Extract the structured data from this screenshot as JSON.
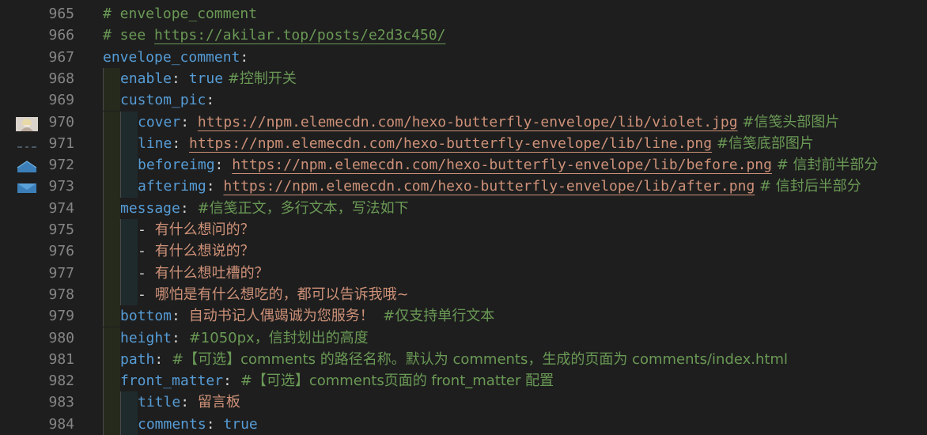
{
  "editor": {
    "lines": [
      {
        "no": "965",
        "parts": [
          {
            "t": "# envelope_comment",
            "c": "comment"
          }
        ]
      },
      {
        "no": "966",
        "parts": [
          {
            "t": "# see ",
            "c": "comment"
          },
          {
            "t": "https://akilar.top/posts/e2d3c450/",
            "c": "url-c"
          }
        ]
      },
      {
        "no": "967",
        "parts": [
          {
            "t": "envelope_comment",
            "c": "key"
          },
          {
            "t": ":",
            "c": "punct"
          }
        ]
      },
      {
        "no": "968",
        "indent": 1,
        "parts": [
          {
            "t": "enable",
            "c": "key"
          },
          {
            "t": ": ",
            "c": "punct"
          },
          {
            "t": "true",
            "c": "bool"
          },
          {
            "t": " #控制开关",
            "c": "cmt-cjk"
          }
        ]
      },
      {
        "no": "969",
        "indent": 1,
        "parts": [
          {
            "t": "custom_pic",
            "c": "key"
          },
          {
            "t": ":",
            "c": "punct"
          }
        ]
      },
      {
        "no": "970",
        "indent": 2,
        "gutter": "avatar-thumbnail",
        "parts": [
          {
            "t": "cover",
            "c": "key"
          },
          {
            "t": ": ",
            "c": "punct"
          },
          {
            "t": "https://npm.elemecdn.com/hexo-butterfly-envelope/lib/violet.jpg",
            "c": "url-s"
          },
          {
            "t": " #信笺头部图片",
            "c": "cmt-cjk"
          }
        ]
      },
      {
        "no": "971",
        "indent": 2,
        "gutter": "line-thumbnail",
        "parts": [
          {
            "t": "line",
            "c": "key"
          },
          {
            "t": ": ",
            "c": "punct"
          },
          {
            "t": "https://npm.elemecdn.com/hexo-butterfly-envelope/lib/line.png",
            "c": "url-s"
          },
          {
            "t": " #信笺底部图片",
            "c": "cmt-cjk"
          }
        ]
      },
      {
        "no": "972",
        "indent": 2,
        "gutter": "envelope-top-thumbnail",
        "parts": [
          {
            "t": "beforeimg",
            "c": "key"
          },
          {
            "t": ": ",
            "c": "punct"
          },
          {
            "t": "https://npm.elemecdn.com/hexo-butterfly-envelope/lib/before.png",
            "c": "url-s"
          },
          {
            "t": " # 信封前半部分",
            "c": "cmt-cjk"
          }
        ]
      },
      {
        "no": "973",
        "indent": 2,
        "gutter": "envelope-bottom-thumbnail",
        "parts": [
          {
            "t": "afterimg",
            "c": "key"
          },
          {
            "t": ": ",
            "c": "punct"
          },
          {
            "t": "https://npm.elemecdn.com/hexo-butterfly-envelope/lib/after.png",
            "c": "url-s"
          },
          {
            "t": " # 信封后半部分",
            "c": "cmt-cjk"
          }
        ]
      },
      {
        "no": "974",
        "indent": 1,
        "parts": [
          {
            "t": "message",
            "c": "key"
          },
          {
            "t": ": ",
            "c": "punct"
          },
          {
            "t": "#信笺正文，多行文本，写法如下",
            "c": "cmt-cjk"
          }
        ]
      },
      {
        "no": "975",
        "indent": 2,
        "parts": [
          {
            "t": "- ",
            "c": "punct"
          },
          {
            "t": "有什么想问的？",
            "c": "str"
          }
        ]
      },
      {
        "no": "976",
        "indent": 2,
        "parts": [
          {
            "t": "- ",
            "c": "punct"
          },
          {
            "t": "有什么想说的？",
            "c": "str"
          }
        ]
      },
      {
        "no": "977",
        "indent": 2,
        "parts": [
          {
            "t": "- ",
            "c": "punct"
          },
          {
            "t": "有什么想吐槽的？",
            "c": "str"
          }
        ]
      },
      {
        "no": "978",
        "indent": 2,
        "parts": [
          {
            "t": "- ",
            "c": "punct"
          },
          {
            "t": "哪怕是有什么想吃的，都可以告诉我哦~",
            "c": "str"
          }
        ]
      },
      {
        "no": "979",
        "indent": 1,
        "parts": [
          {
            "t": "bottom",
            "c": "key"
          },
          {
            "t": ": ",
            "c": "punct"
          },
          {
            "t": "自动书记人偶竭诚为您服务！",
            "c": "str"
          },
          {
            "t": "  #仅支持单行文本",
            "c": "cmt-cjk"
          }
        ]
      },
      {
        "no": "980",
        "indent": 1,
        "parts": [
          {
            "t": "height",
            "c": "key"
          },
          {
            "t": ": ",
            "c": "punct"
          },
          {
            "t": "#1050px，信封划出的高度",
            "c": "cmt-cjk"
          }
        ]
      },
      {
        "no": "981",
        "indent": 1,
        "parts": [
          {
            "t": "path",
            "c": "key"
          },
          {
            "t": ": ",
            "c": "punct"
          },
          {
            "t": "#【可选】comments 的路径名称。默认为 comments，生成的页面为 comments/index.html",
            "c": "cmt-cjk"
          }
        ]
      },
      {
        "no": "982",
        "indent": 1,
        "parts": [
          {
            "t": "front_matter",
            "c": "key"
          },
          {
            "t": ": ",
            "c": "punct"
          },
          {
            "t": "#【可选】comments页面的 front_matter 配置",
            "c": "cmt-cjk"
          }
        ]
      },
      {
        "no": "983",
        "indent": 2,
        "parts": [
          {
            "t": "title",
            "c": "key"
          },
          {
            "t": ": ",
            "c": "punct"
          },
          {
            "t": "留言板",
            "c": "str"
          }
        ]
      },
      {
        "no": "984",
        "indent": 2,
        "parts": [
          {
            "t": "comments",
            "c": "key"
          },
          {
            "t": ": ",
            "c": "punct"
          },
          {
            "t": "true",
            "c": "bool"
          }
        ]
      }
    ]
  }
}
